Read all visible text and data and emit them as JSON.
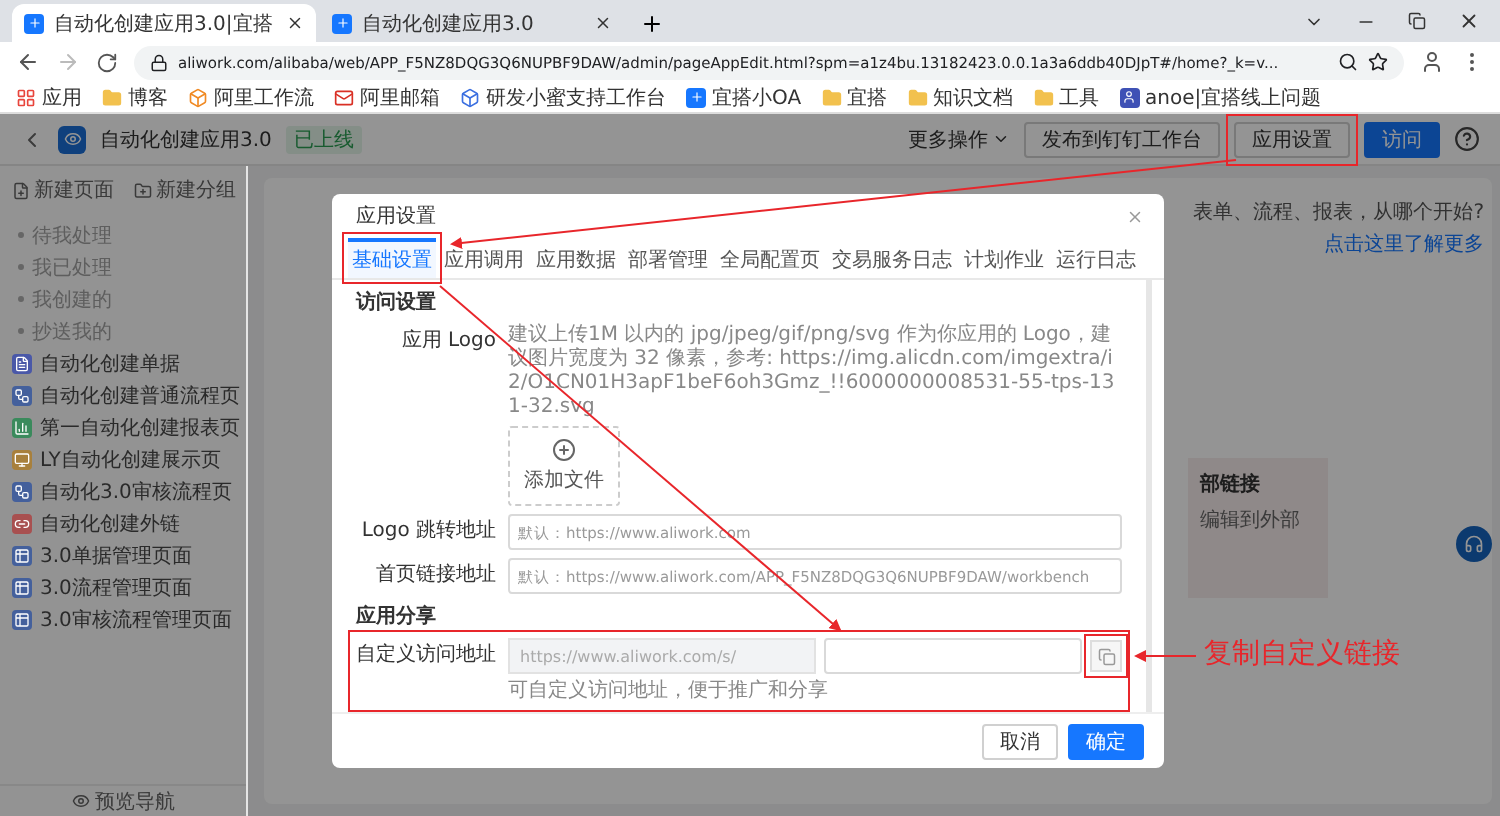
{
  "browser": {
    "tabs": [
      {
        "title": "自动化创建应用3.0|宜搭",
        "selected": true
      },
      {
        "title": "自动化创建应用3.0",
        "selected": false
      }
    ],
    "url": "aliwork.com/alibaba/web/APP_F5NZ8DQG3Q6NUPBF9DAW/admin/pageAppEdit.html?spm=a1z4bu.13182423.0.0.1a3a6ddb40DJpT#/home?_k=v...",
    "bookmarks": [
      {
        "label": "应用",
        "kind": "apps"
      },
      {
        "label": "博客",
        "kind": "folder"
      },
      {
        "label": "阿里工作流",
        "kind": "site",
        "color": "#f08a24"
      },
      {
        "label": "阿里邮箱",
        "kind": "mail",
        "color": "#d93025"
      },
      {
        "label": "研发小蜜支持工作台",
        "kind": "site",
        "color": "#3b6fe0"
      },
      {
        "label": "宜搭小OA",
        "kind": "logo",
        "color": "#1677ff"
      },
      {
        "label": "宜搭",
        "kind": "folder"
      },
      {
        "label": "知识文档",
        "kind": "folder"
      },
      {
        "label": "工具",
        "kind": "folder"
      },
      {
        "label": "anoe|宜搭线上问题",
        "kind": "letter",
        "color": "#3f51b5"
      }
    ]
  },
  "header": {
    "title": "自动化创建应用3.0",
    "badge": "已上线",
    "more": "更多操作",
    "publish": "发布到钉钉工作台",
    "settings": "应用设置",
    "visit": "访问"
  },
  "sidebar": {
    "actions": [
      "新建页面",
      "新建分组"
    ],
    "items": [
      {
        "label": "待我处理",
        "kind": "group"
      },
      {
        "label": "我已处理",
        "kind": "group"
      },
      {
        "label": "我创建的",
        "kind": "group"
      },
      {
        "label": "抄送我的",
        "kind": "group"
      },
      {
        "label": "自动化创建单据",
        "kind": "form",
        "color": "#4a58a8"
      },
      {
        "label": "自动化创建普通流程页",
        "kind": "flow",
        "color": "#44609c"
      },
      {
        "label": "第一自动化创建报表页",
        "kind": "report",
        "color": "#3a8a5c"
      },
      {
        "label": "LY自动化创建展示页",
        "kind": "display",
        "color": "#a8803c"
      },
      {
        "label": "自动化3.0审核流程页",
        "kind": "flow",
        "color": "#44609c"
      },
      {
        "label": "自动化创建外链",
        "kind": "link",
        "color": "#a85050"
      },
      {
        "label": "3.0单据管理页面",
        "kind": "manage",
        "color": "#44609c"
      },
      {
        "label": "3.0流程管理页面",
        "kind": "manage",
        "color": "#44609c"
      },
      {
        "label": "3.0审核流程管理页面",
        "kind": "manage",
        "color": "#44609c"
      }
    ],
    "footer": "预览导航"
  },
  "main": {
    "hint": "表单、流程、报表，从哪个开始?",
    "hint_link": "点击这里了解更多",
    "card_title": "部链接",
    "card_text": "编辑到外部"
  },
  "modal": {
    "title": "应用设置",
    "tabs": [
      {
        "label": "基础设置",
        "selected": true
      },
      {
        "label": "应用调用",
        "selected": false
      },
      {
        "label": "应用数据",
        "selected": false
      },
      {
        "label": "部署管理",
        "selected": false
      },
      {
        "label": "全局配置页",
        "selected": false
      },
      {
        "label": "交易服务日志",
        "selected": false
      },
      {
        "label": "计划作业",
        "selected": false
      },
      {
        "label": "运行日志",
        "selected": false
      }
    ],
    "access_heading": "访问设置",
    "logo_label": "应用 Logo",
    "logo_hint": "建议上传1M 以内的 jpg/jpeg/gif/png/svg 作为你应用的 Logo，建议图片宽度为 32 像素，参考: https://img.alicdn.com/imgextra/i2/O1CN01H3apF1beF6oh3Gmz_!!6000000008531-55-tps-131-32.svg",
    "upload_label": "添加文件",
    "logo_link_label": "Logo 跳转地址",
    "logo_link_placeholder": "默认：https://www.aliwork.com",
    "home_link_label": "首页链接地址",
    "home_link_placeholder": "默认：https://www.aliwork.com/APP_F5NZ8DQG3Q6NUPBF9DAW/workbench",
    "share_heading": "应用分享",
    "custom_label": "自定义访问地址",
    "custom_prefix": "https://www.aliwork.com/s/",
    "custom_hint": "可自定义访问地址，便于推广和分享",
    "cancel": "取消",
    "ok": "确定"
  },
  "annotation": {
    "note": "复制自定义链接"
  }
}
